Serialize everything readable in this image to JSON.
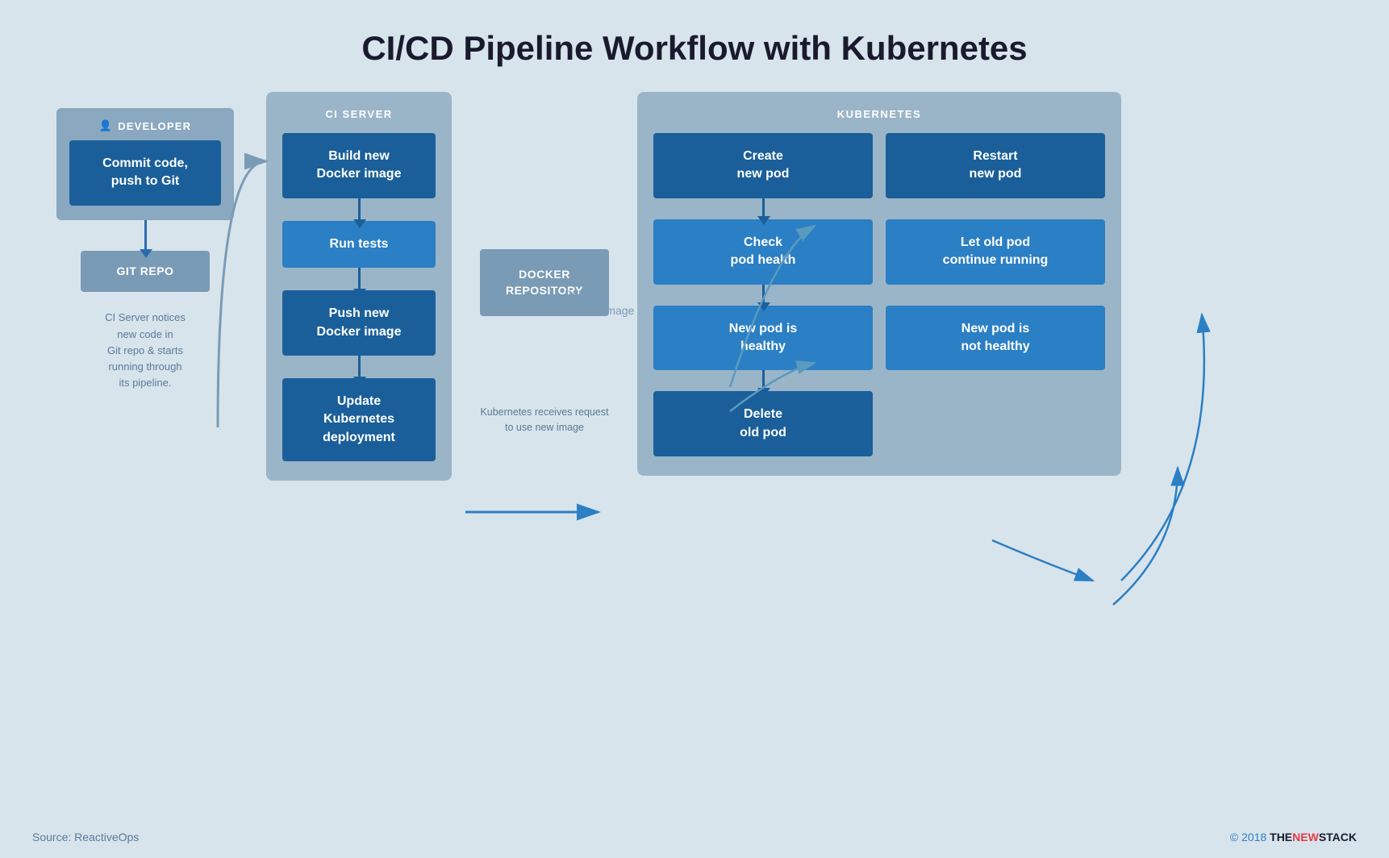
{
  "title": "CI/CD Pipeline Workflow with Kubernetes",
  "developer": {
    "label": "DEVELOPER",
    "icon": "👤",
    "commit_box": "Commit code,\npush to Git",
    "git_repo": "GIT REPO",
    "ci_notice": "CI Server notices\nnew code in\nGit repo & starts\nrunning through\nits pipeline."
  },
  "ci_server": {
    "label": "CI SERVER",
    "steps": [
      "Build new\nDocker image",
      "Run tests",
      "Push new\nDocker image",
      "Update\nKubernetes\ndeployment"
    ]
  },
  "docker": {
    "label": "DOCKER\nREPOSITORY",
    "sub_text": "Kubernetes receives request\nto use new image"
  },
  "docker_pull_label": "Pull new\nDocker image",
  "kubernetes": {
    "label": "KUBERNETES",
    "boxes": [
      "Create\nnew pod",
      "Restart\nnew pod",
      "Check\npod health",
      "Let old pod\ncontinue running",
      "New pod is\nhealthy",
      "New pod is\nnot healthy",
      "Delete\nold pod"
    ]
  },
  "footer": {
    "source": "Source: ReactiveOps",
    "copyright": "© 2018",
    "brand": "THENEWSTACK",
    "brand_new": "NEW"
  }
}
